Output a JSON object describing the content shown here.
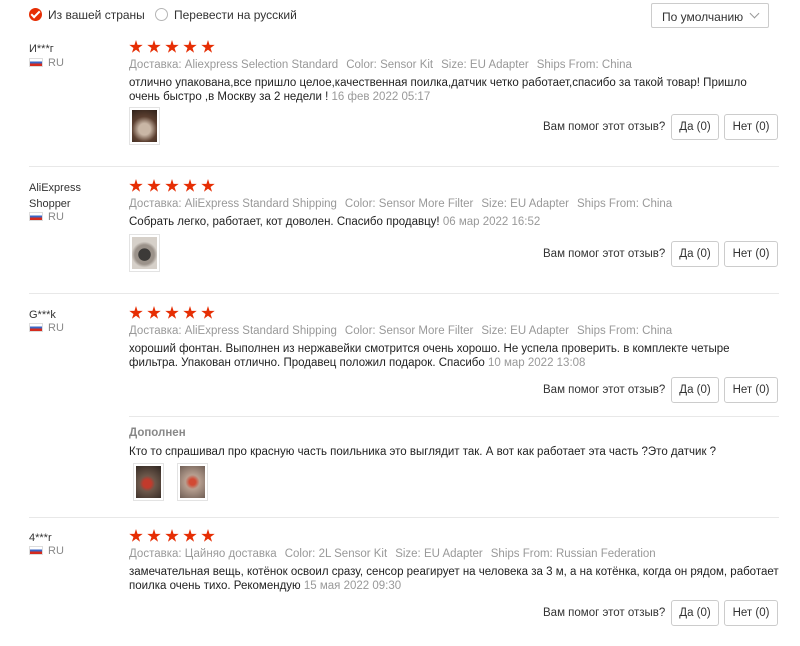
{
  "filters": {
    "from_country": "Из вашей страны",
    "translate": "Перевести на русский",
    "sort": "По умолчанию"
  },
  "labels": {
    "helpful": "Вам помог этот отзыв?",
    "yes": "Да (0)",
    "no": "Нет (0)",
    "added": "Дополнен"
  },
  "reviews": [
    {
      "user": "И***г",
      "country": "RU",
      "rating": 5,
      "shipping": "Доставка: Aliexpress Selection Standard",
      "color": "Color: Sensor Kit",
      "size": "Size: EU Adapter",
      "ships_from": "Ships From: China",
      "text": "отлично упакована,все пришло целое,качественная поилка,датчик четко работает,спасибо за такой товар! Пришло очень быстро ,в Москву за 2 недели !",
      "date": "16 фев 2022 05:17"
    },
    {
      "user": "AliExpress Shopper",
      "country": "RU",
      "rating": 5,
      "shipping": "Доставка: AliExpress Standard Shipping",
      "color": "Color: Sensor More Filter",
      "size": "Size: EU Adapter",
      "ships_from": "Ships From: China",
      "text": "Собрать легко, работает, кот доволен. Спасибо продавцу!",
      "date": "06 мар 2022 16:52"
    },
    {
      "user": "G***k",
      "country": "RU",
      "rating": 5,
      "shipping": "Доставка: AliExpress Standard Shipping",
      "color": "Color: Sensor More Filter",
      "size": "Size: EU Adapter",
      "ships_from": "Ships From: China",
      "text": "хороший фонтан. Выполнен из нержавейки смотрится очень хорошо. Не успела проверить. в комплекте четыре фильтра. Упакован отлично. Продавец положил подарок. Спасибо",
      "date": "10 мар 2022 13:08",
      "addition": "Кто то спрашивал про красную часть поильника это выглядит так. А вот как работает эта часть ?Это датчик ?"
    },
    {
      "user": "4***r",
      "country": "RU",
      "rating": 5,
      "shipping": "Доставка: Цайняо доставка",
      "color": "Color: 2L Sensor Kit",
      "size": "Size: EU Adapter",
      "ships_from": "Ships From: Russian Federation",
      "text": "замечательная вещь, котёнок освоил сразу, сенсор реагирует на человека за 3 м, а на котёнка, когда он рядом, работает поилка очень тихо. Рекомендую",
      "date": "15 мая 2022 09:30"
    }
  ],
  "colors": {
    "accent": "#e62e04",
    "muted": "#999999",
    "border": "#cccccc"
  },
  "icons": [
    "checkbox-checked-icon",
    "checkbox-empty-icon",
    "chevron-down-icon",
    "star-icon",
    "flag-ru-icon"
  ]
}
